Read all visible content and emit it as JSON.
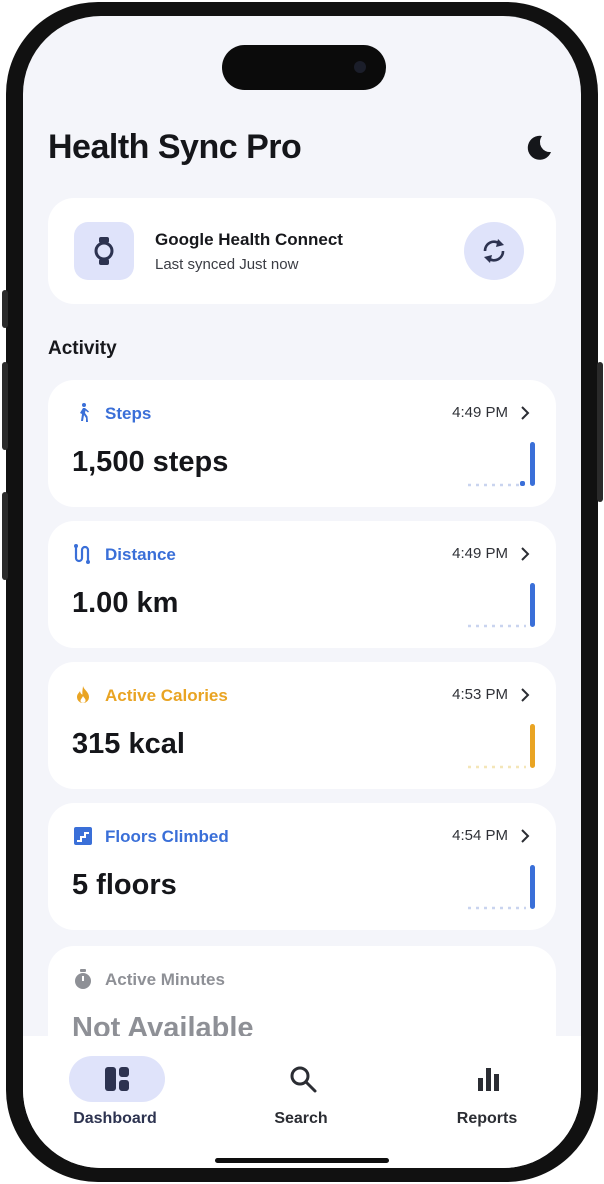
{
  "app": {
    "title": "Health Sync Pro"
  },
  "icons": {
    "theme": "moon-icon",
    "watch": "watch-icon",
    "sync": "sync-icon",
    "steps": "walking-icon",
    "distance": "route-icon",
    "calories": "flame-icon",
    "floors": "stairs-icon",
    "minutes": "stopwatch-icon"
  },
  "sync_card": {
    "name": "Google Health Connect",
    "status": "Last synced Just now"
  },
  "activity": {
    "title": "Activity",
    "metrics": [
      {
        "name": "Steps",
        "time": "4:49 PM",
        "value": "1,500 steps",
        "color": "#3a6fd8"
      },
      {
        "name": "Distance",
        "time": "4:49 PM",
        "value": "1.00 km",
        "color": "#3a6fd8"
      },
      {
        "name": "Active Calories",
        "time": "4:53 PM",
        "value": "315 kcal",
        "color": "#e9a423"
      },
      {
        "name": "Floors Climbed",
        "time": "4:54 PM",
        "value": "5 floors",
        "color": "#3a6fd8"
      },
      {
        "name": "Active Minutes",
        "value": "Not Available",
        "color": "#8e9096"
      }
    ]
  },
  "nav": {
    "items": [
      {
        "label": "Dashboard",
        "active": true
      },
      {
        "label": "Search",
        "active": false
      },
      {
        "label": "Reports",
        "active": false
      }
    ]
  },
  "colors": {
    "accent_blue": "#3a6fd8",
    "accent_orange": "#e9a423",
    "tile_bg": "#dfe3fa",
    "screen_bg": "#f4f5fa"
  }
}
